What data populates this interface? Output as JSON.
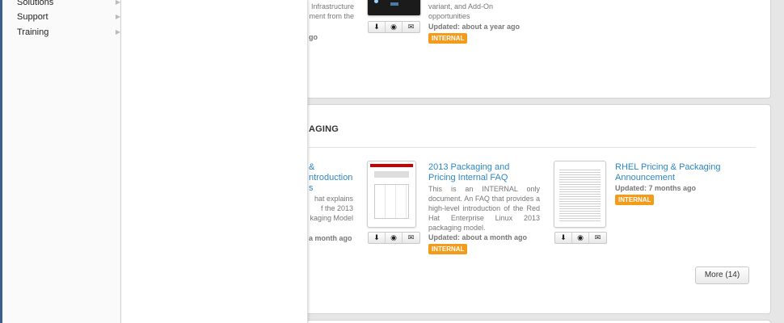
{
  "nav": {
    "items": [
      {
        "label": "Solutions"
      },
      {
        "label": "Support"
      },
      {
        "label": "Training"
      }
    ]
  },
  "panel1": {
    "partial_desc": "Infrastructure\nment from the",
    "partial_updated": "go",
    "item": {
      "desc": "variant, and Add-On\nopportunities",
      "updated": "Updated: about a year ago",
      "badge": "INTERNAL"
    }
  },
  "panel2": {
    "section_title": "AGING",
    "partial": {
      "title": "&\nntroduction\ns",
      "desc": "hat explains\nf the 2013\nkaging Model",
      "updated": "a month ago"
    },
    "items": [
      {
        "title": "2013 Packaging and Pricing Internal FAQ",
        "desc": "This is an INTERNAL only document. An FAQ that provides a high-level introduction of the Red Hat Enterprise Linux 2013 packaging model.",
        "updated": "Updated: about a month ago",
        "badge": "INTERNAL"
      },
      {
        "title": "RHEL Pricing & Packaging Announcement",
        "updated": "Updated: 7 months ago",
        "badge": "INTERNAL"
      }
    ],
    "more_label": "More (14)"
  },
  "icons": {
    "download": "download-icon",
    "preview": "eye-icon",
    "email": "envelope-icon"
  },
  "colors": {
    "link": "#2e87c3",
    "badge": "#f39b1b",
    "nav_accent": "#3b5d8f"
  }
}
